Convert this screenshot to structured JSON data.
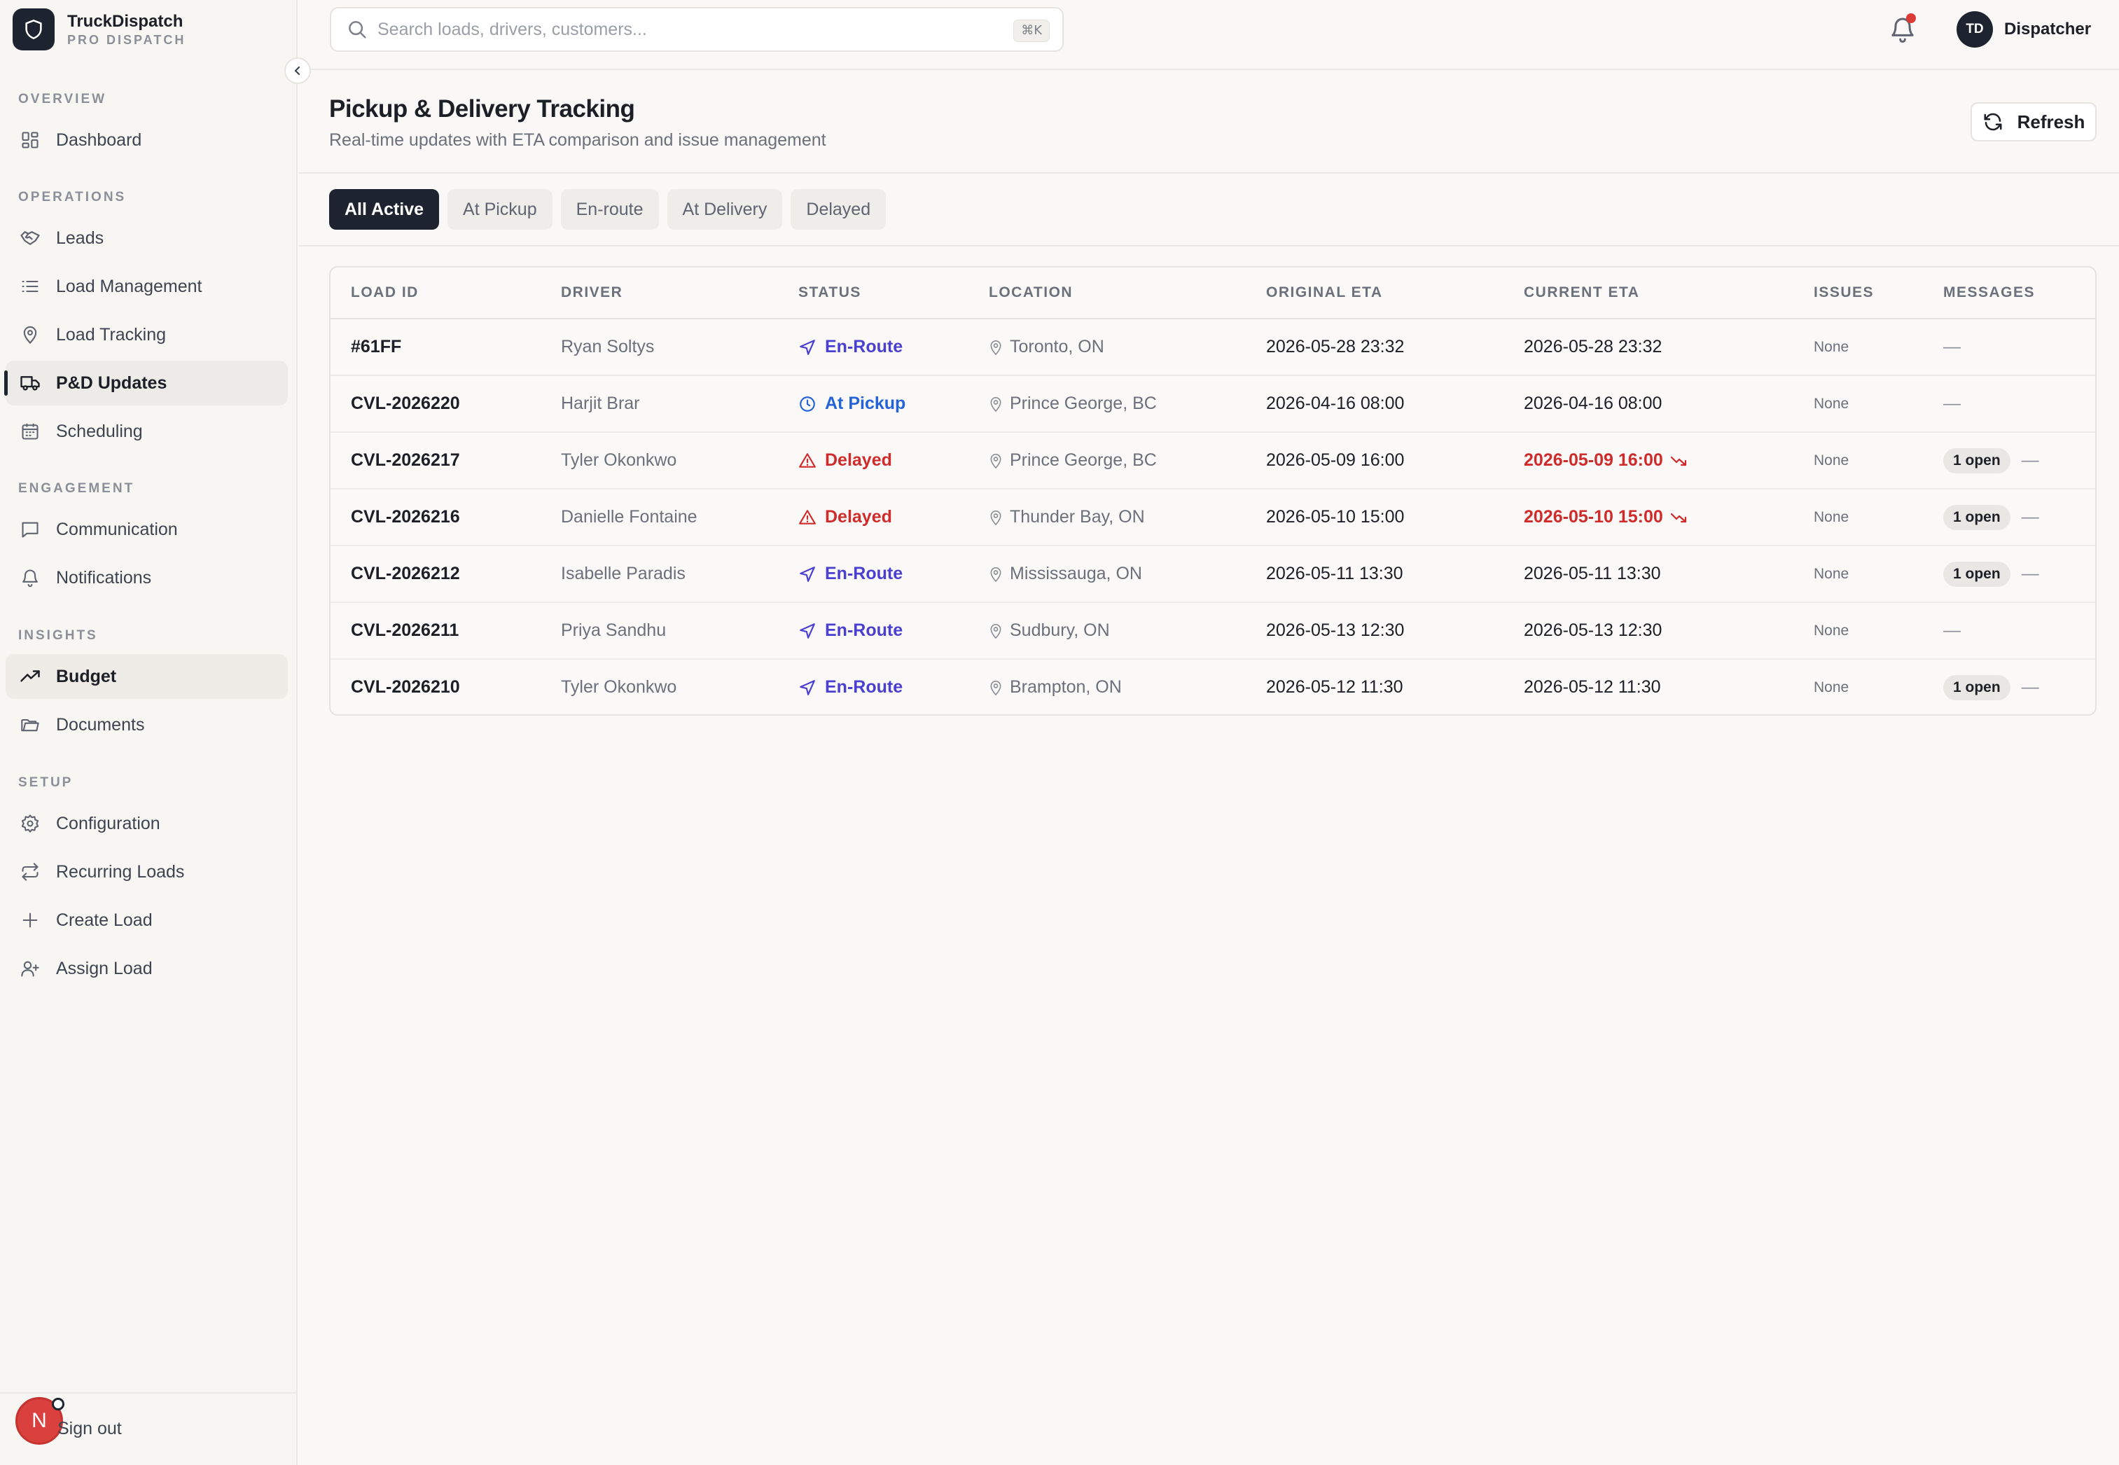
{
  "brand": {
    "name": "TruckDispatch",
    "subtitle": "PRO DISPATCH"
  },
  "sidebar": {
    "sections": [
      {
        "heading": "OVERVIEW",
        "items": [
          {
            "label": "Dashboard",
            "icon": "dashboard-icon"
          }
        ]
      },
      {
        "heading": "OPERATIONS",
        "items": [
          {
            "label": "Leads",
            "icon": "handshake-icon"
          },
          {
            "label": "Load Management",
            "icon": "list-icon"
          },
          {
            "label": "Load Tracking",
            "icon": "map-pin-icon"
          },
          {
            "label": "P&D Updates",
            "icon": "truck-icon",
            "active": true
          },
          {
            "label": "Scheduling",
            "icon": "calendar-icon"
          }
        ]
      },
      {
        "heading": "ENGAGEMENT",
        "items": [
          {
            "label": "Communication",
            "icon": "message-icon"
          },
          {
            "label": "Notifications",
            "icon": "bell-icon"
          }
        ]
      },
      {
        "heading": "INSIGHTS",
        "items": [
          {
            "label": "Budget",
            "icon": "trending-up-icon",
            "highlight": true
          },
          {
            "label": "Documents",
            "icon": "folder-icon"
          }
        ]
      },
      {
        "heading": "SETUP",
        "items": [
          {
            "label": "Configuration",
            "icon": "gear-icon"
          },
          {
            "label": "Recurring Loads",
            "icon": "repeat-icon"
          },
          {
            "label": "Create Load",
            "icon": "plus-icon"
          },
          {
            "label": "Assign Load",
            "icon": "user-plus-icon"
          }
        ]
      }
    ],
    "signout_label": "Sign out",
    "avatar_letter": "N"
  },
  "topbar": {
    "search_placeholder": "Search loads, drivers, customers...",
    "shortcut": "⌘K",
    "user_initials": "TD",
    "user_name": "Dispatcher"
  },
  "page": {
    "title": "Pickup & Delivery Tracking",
    "subtitle": "Real-time updates with ETA comparison and issue management",
    "refresh_label": "Refresh"
  },
  "tabs": [
    {
      "label": "All Active",
      "active": true
    },
    {
      "label": "At Pickup"
    },
    {
      "label": "En-route"
    },
    {
      "label": "At Delivery"
    },
    {
      "label": "Delayed"
    }
  ],
  "table": {
    "headers": {
      "load_id": "LOAD ID",
      "driver": "DRIVER",
      "status": "STATUS",
      "location": "LOCATION",
      "original_eta": "ORIGINAL ETA",
      "current_eta": "CURRENT ETA",
      "issues": "ISSUES",
      "messages": "MESSAGES"
    },
    "rows": [
      {
        "load_id": "#61FF",
        "driver": "Ryan Soltys",
        "status": "En-Route",
        "status_kind": "enroute",
        "location": "Toronto, ON",
        "original_eta": "2026-05-28 23:32",
        "current_eta": "2026-05-28 23:32",
        "late": false,
        "issues": "None",
        "messages_badge": "",
        "messages_dash": "—"
      },
      {
        "load_id": "CVL-2026220",
        "driver": "Harjit Brar",
        "status": "At Pickup",
        "status_kind": "pickup",
        "location": "Prince George, BC",
        "original_eta": "2026-04-16 08:00",
        "current_eta": "2026-04-16 08:00",
        "late": false,
        "issues": "None",
        "messages_badge": "",
        "messages_dash": "—"
      },
      {
        "load_id": "CVL-2026217",
        "driver": "Tyler Okonkwo",
        "status": "Delayed",
        "status_kind": "delayed",
        "location": "Prince George, BC",
        "original_eta": "2026-05-09 16:00",
        "current_eta": "2026-05-09 16:00",
        "late": true,
        "issues": "None",
        "messages_badge": "1 open",
        "messages_dash": "—"
      },
      {
        "load_id": "CVL-2026216",
        "driver": "Danielle Fontaine",
        "status": "Delayed",
        "status_kind": "delayed",
        "location": "Thunder Bay, ON",
        "original_eta": "2026-05-10 15:00",
        "current_eta": "2026-05-10 15:00",
        "late": true,
        "issues": "None",
        "messages_badge": "1 open",
        "messages_dash": "—"
      },
      {
        "load_id": "CVL-2026212",
        "driver": "Isabelle Paradis",
        "status": "En-Route",
        "status_kind": "enroute",
        "location": "Mississauga, ON",
        "original_eta": "2026-05-11 13:30",
        "current_eta": "2026-05-11 13:30",
        "late": false,
        "issues": "None",
        "messages_badge": "1 open",
        "messages_dash": "—"
      },
      {
        "load_id": "CVL-2026211",
        "driver": "Priya Sandhu",
        "status": "En-Route",
        "status_kind": "enroute",
        "location": "Sudbury, ON",
        "original_eta": "2026-05-13 12:30",
        "current_eta": "2026-05-13 12:30",
        "late": false,
        "issues": "None",
        "messages_badge": "",
        "messages_dash": "—"
      },
      {
        "load_id": "CVL-2026210",
        "driver": "Tyler Okonkwo",
        "status": "En-Route",
        "status_kind": "enroute",
        "location": "Brampton, ON",
        "original_eta": "2026-05-12 11:30",
        "current_eta": "2026-05-12 11:30",
        "late": false,
        "issues": "None",
        "messages_badge": "1 open",
        "messages_dash": "—"
      }
    ]
  },
  "colors": {
    "accent_dark": "#1d2430",
    "enroute": "#4a3fd1",
    "pickup": "#2563d9",
    "delayed": "#d02b2b",
    "notification_dot": "#dc3a34"
  }
}
